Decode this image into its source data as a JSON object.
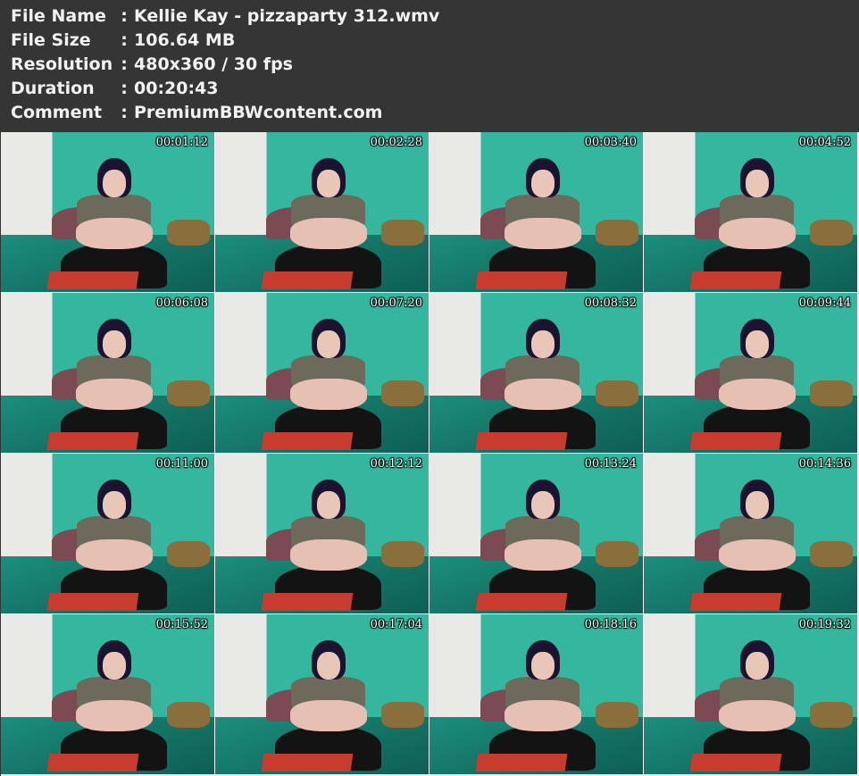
{
  "file_info": [
    {
      "label": "File Name",
      "sep": ":",
      "value": "Kellie Kay - pizzaparty 312.wmv"
    },
    {
      "label": "File Size",
      "sep": ":",
      "value": "106.64 MB"
    },
    {
      "label": "Resolution",
      "sep": ":",
      "value": "480x360 / 30 fps"
    },
    {
      "label": "Duration",
      "sep": ":",
      "value": "00:20:43"
    },
    {
      "label": "Comment",
      "sep": ":",
      "value": "PremiumBBWcontent.com"
    }
  ],
  "thumbnails": [
    "00:01:12",
    "00:02:28",
    "00:03:40",
    "00:04:52",
    "00:06:08",
    "00:07:20",
    "00:08:32",
    "00:09:44",
    "00:11:00",
    "00:12:12",
    "00:13:24",
    "00:14:36",
    "00:15:52",
    "00:17:04",
    "00:18:16",
    "00:19:32"
  ],
  "colors": {
    "header_bg": "#353535",
    "header_text": "#f2f2f2",
    "wall_teal": "#34b79e",
    "timestamp_text": "#ffffff"
  }
}
